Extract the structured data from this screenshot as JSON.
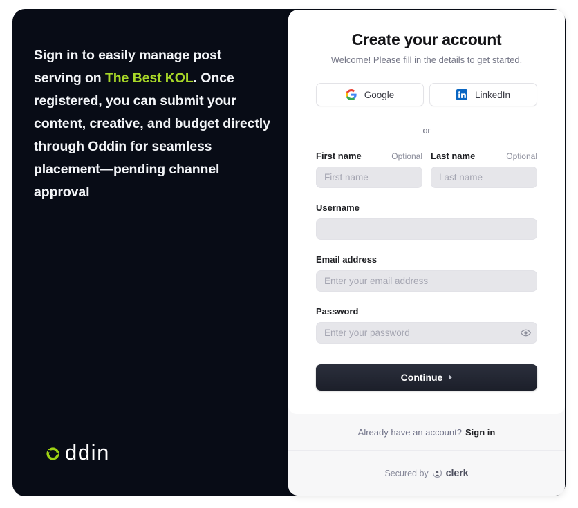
{
  "hero": {
    "text_before": "Sign in to easily manage post serving on ",
    "accent": "The Best KOL",
    "text_after": ". Once registered, you can submit your content, creative, and budget directly through Oddin for seamless placement—pending channel approval",
    "accent_color": "#a8d728",
    "panel_bg": "#080c16"
  },
  "brand": {
    "mark_name": "oddin-logo-mark",
    "word": "ddin",
    "mark_color": "#a8d728"
  },
  "card": {
    "title": "Create your account",
    "subtitle": "Welcome! Please fill in the details to get started."
  },
  "social": [
    {
      "label": "Google",
      "icon": "google-icon"
    },
    {
      "label": "LinkedIn",
      "icon": "linkedin-icon"
    }
  ],
  "divider": {
    "label": "or"
  },
  "fields": {
    "first_name": {
      "label": "First name",
      "optional": "Optional",
      "placeholder": "First name",
      "value": ""
    },
    "last_name": {
      "label": "Last name",
      "optional": "Optional",
      "placeholder": "Last name",
      "value": ""
    },
    "username": {
      "label": "Username",
      "placeholder": "",
      "value": ""
    },
    "email": {
      "label": "Email address",
      "placeholder": "Enter your email address",
      "value": ""
    },
    "password": {
      "label": "Password",
      "placeholder": "Enter your password",
      "value": "",
      "toggle_icon": "eye-icon"
    }
  },
  "submit": {
    "label": "Continue",
    "icon": "caret-right-icon"
  },
  "footer": {
    "account_prompt": "Already have an account?",
    "signin_label": "Sign in",
    "secured_text": "Secured by",
    "secured_brand": "clerk"
  }
}
